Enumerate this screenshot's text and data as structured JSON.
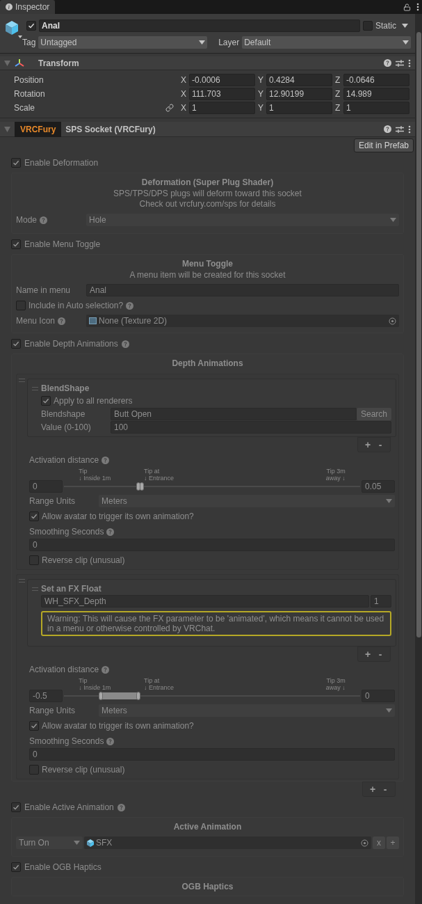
{
  "tab": {
    "label": "Inspector",
    "selected": true
  },
  "object": {
    "active": true,
    "name": "Anal",
    "static": false,
    "static_label": "Static",
    "tag_label": "Tag",
    "tag": "Untagged",
    "layer_label": "Layer",
    "layer": "Default"
  },
  "transform": {
    "expanded": true,
    "title": "Transform",
    "rows": [
      {
        "label": "Position",
        "linked": false,
        "axes": [
          {
            "axis": "X",
            "value": "-0.0006"
          },
          {
            "axis": "Y",
            "value": "0.4284"
          },
          {
            "axis": "Z",
            "value": "-0.0646"
          }
        ]
      },
      {
        "label": "Rotation",
        "linked": false,
        "axes": [
          {
            "axis": "X",
            "value": "111.703"
          },
          {
            "axis": "Y",
            "value": "12.90199"
          },
          {
            "axis": "Z",
            "value": "14.989"
          }
        ]
      },
      {
        "label": "Scale",
        "linked": true,
        "axes": [
          {
            "axis": "X",
            "value": "1"
          },
          {
            "axis": "Y",
            "value": "1"
          },
          {
            "axis": "Z",
            "value": "1"
          }
        ]
      }
    ]
  },
  "component": {
    "expanded": true,
    "disabled": true,
    "badge": "VRCFury",
    "title": "SPS Socket (VRCFury)",
    "tooltip": "Edit in Prefab",
    "deformation": {
      "toggle": {
        "label": "Enable Deformation",
        "checked": true,
        "help": false
      },
      "title": "Deformation (Super Plug Shader)",
      "lines": [
        "SPS/TPS/DPS plugs will deform toward this socket",
        "Check out vrcfury.com/sps for details"
      ],
      "mode": {
        "label": "Mode",
        "help": true,
        "value": "Hole"
      }
    },
    "menu_toggle": {
      "toggle": {
        "label": "Enable Menu Toggle",
        "checked": true,
        "help": false
      },
      "title": "Menu Toggle",
      "lines": [
        "A menu item will be created for this socket"
      ],
      "name_field": {
        "label": "Name in menu",
        "value": "Anal"
      },
      "auto": {
        "label": "Include in Auto selection?",
        "checked": false,
        "help": true
      },
      "icon": {
        "label": "Menu Icon",
        "help": true,
        "value": "None (Texture 2D)"
      }
    },
    "depth": {
      "toggle": {
        "label": "Enable Depth Animations",
        "checked": true,
        "help": true
      },
      "title": "Depth Animations",
      "list_buttons": [
        "+",
        "-"
      ],
      "entries": [
        {
          "action": {
            "kind": "blendshape",
            "title": "BlendShape",
            "apply": {
              "label": "Apply to all renderers",
              "checked": true
            },
            "blendshape": {
              "label": "Blendshape",
              "value": "Butt Open",
              "button": "Search"
            },
            "amount": {
              "label": "Value (0-100)",
              "value": "100"
            }
          },
          "action_buttons": [
            "+",
            "-"
          ],
          "distance": {
            "label": "Activation distance",
            "help": true,
            "min": "0",
            "max": "0.05",
            "ticks": [
              [
                "Tip",
                "↓ Inside 1m"
              ],
              [
                "Tip at",
                "↓ Entrance"
              ],
              [
                "Tip 3m",
                "away ↓"
              ]
            ],
            "handles": [
              {
                "level": 0.25
              },
              {
                "level": 0.262
              }
            ]
          },
          "units": {
            "label": "Range Units",
            "value": "Meters"
          },
          "allow": {
            "label": "Allow avatar to trigger its own animation?",
            "checked": true
          },
          "smoothing": {
            "label": "Smoothing Seconds",
            "help": true,
            "value": "0"
          },
          "reverse": {
            "label": "Reverse clip (unusual)",
            "checked": false
          }
        },
        {
          "action": {
            "kind": "fx_float",
            "title": "Set an FX Float",
            "param": "WH_SFX_Depth",
            "value": "1",
            "warning": "Warning: This will cause the FX parameter to be 'animated', which means it cannot be used in a menu or otherwise controlled by VRChat."
          },
          "action_buttons": [
            "+",
            "-"
          ],
          "distance": {
            "label": "Activation distance",
            "help": true,
            "min": "-0.5",
            "max": "0",
            "ticks": [
              [
                "Tip",
                "↓ Inside 1m"
              ],
              [
                "Tip at",
                "↓ Entrance"
              ],
              [
                "Tip 3m",
                "away ↓"
              ]
            ],
            "handles": [
              {
                "level": 0.125
              },
              {
                "level": 0.25
              }
            ]
          },
          "units": {
            "label": "Range Units",
            "value": "Meters"
          },
          "allow": {
            "label": "Allow avatar to trigger its own animation?",
            "checked": true
          },
          "smoothing": {
            "label": "Smoothing Seconds",
            "help": true,
            "value": "0"
          },
          "reverse": {
            "label": "Reverse clip (unusual)",
            "checked": false
          }
        }
      ]
    },
    "active": {
      "toggle": {
        "label": "Enable Active Animation",
        "checked": true,
        "help": true
      },
      "title": "Active Animation",
      "mode": "Turn On",
      "object": "SFX",
      "buttons": [
        "x",
        "+"
      ]
    },
    "ogb": {
      "toggle": {
        "label": "Enable OGB Haptics",
        "checked": true,
        "help": false
      },
      "title": "OGB Haptics"
    }
  }
}
